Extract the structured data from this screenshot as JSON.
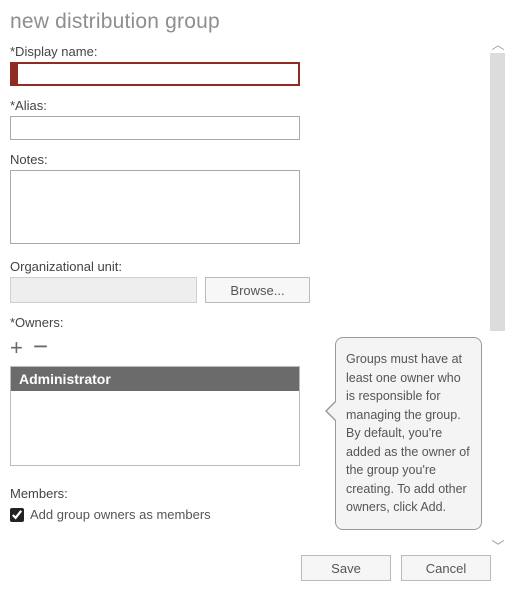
{
  "title": "new distribution group",
  "fields": {
    "display_name_label": "*Display name:",
    "display_name_value": "",
    "alias_label": "*Alias:",
    "alias_value": "",
    "notes_label": "Notes:",
    "notes_value": "",
    "org_unit_label": "Organizational unit:",
    "org_unit_value": "",
    "browse_label": "Browse...",
    "owners_label": "*Owners:",
    "owners_list": [
      "Administrator"
    ],
    "members_label": "Members:",
    "add_owners_checkbox_label": "Add group owners as members",
    "add_owners_checked": true
  },
  "tooltip": "Groups must have at least one owner who is responsible for managing the group. By default, you're added as the owner of the group you're creating. To add other owners, click Add.",
  "buttons": {
    "save": "Save",
    "cancel": "Cancel"
  },
  "icons": {
    "plus": "+",
    "minus": "−",
    "up": "︿",
    "down": "﹀"
  }
}
